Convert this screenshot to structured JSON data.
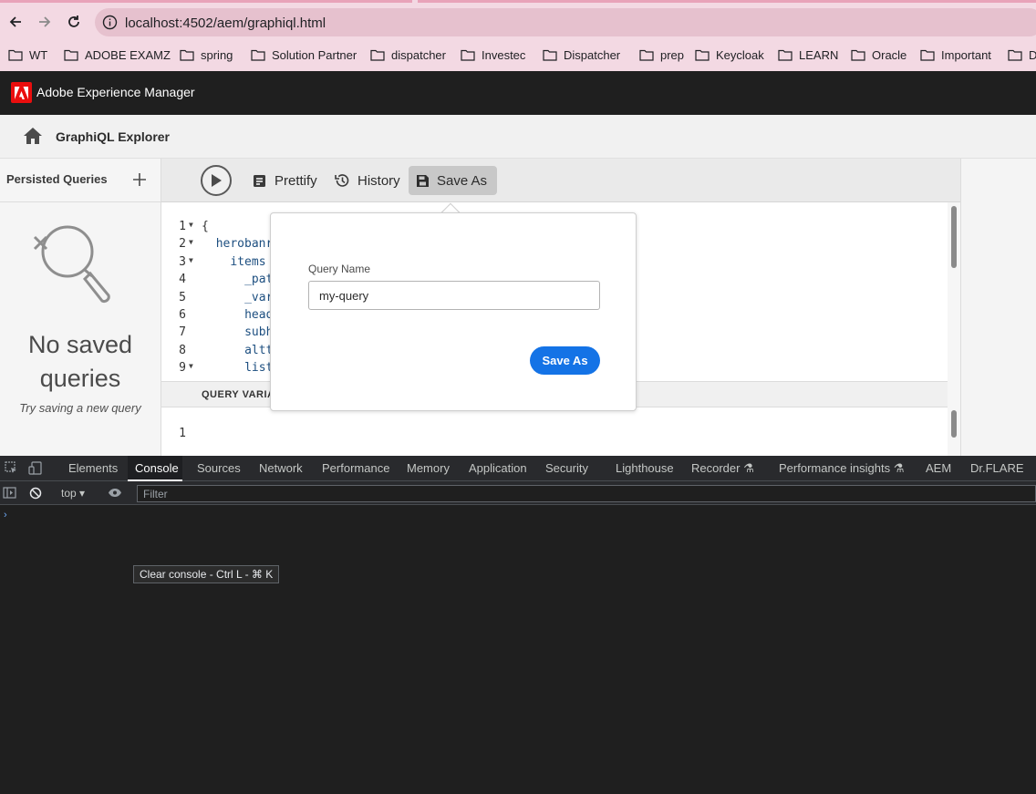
{
  "browser": {
    "url": "localhost:4502/aem/graphiql.html",
    "bookmarks": [
      "WT",
      "ADOBE EXAMZ",
      "spring",
      "Solution Partner",
      "dispatcher",
      "Investec",
      "Dispatcher",
      "prep",
      "Keycloak",
      "LEARN",
      "Oracle",
      "Important",
      "Di"
    ]
  },
  "aem": {
    "product_name": "Adobe Experience Manager",
    "page_title": "GraphiQL Explorer"
  },
  "persisted_queries": {
    "title": "Persisted Queries",
    "empty_title": "No saved queries",
    "empty_subtitle": "Try saving a new query"
  },
  "toolbar": {
    "prettify_label": "Prettify",
    "history_label": "History",
    "save_as_label": "Save As"
  },
  "editor": {
    "lines": [
      {
        "n": "1",
        "text": "{",
        "indent": 0,
        "fold": true
      },
      {
        "n": "2",
        "text": "herobanr",
        "indent": 1,
        "fold": true
      },
      {
        "n": "3",
        "text": "items",
        "indent": 2,
        "fold": true
      },
      {
        "n": "4",
        "text": "_pat",
        "indent": 3,
        "fold": false
      },
      {
        "n": "5",
        "text": "_var",
        "indent": 3,
        "fold": false
      },
      {
        "n": "6",
        "text": "head",
        "indent": 3,
        "fold": false
      },
      {
        "n": "7",
        "text": "subh",
        "indent": 3,
        "fold": false
      },
      {
        "n": "8",
        "text": "altt",
        "indent": 3,
        "fold": false
      },
      {
        "n": "9",
        "text": "list",
        "indent": 3,
        "fold": true
      }
    ],
    "variables_label": "QUERY VARIA",
    "variables_line": "1"
  },
  "save_popover": {
    "label": "Query Name",
    "value": "my-query",
    "button_label": "Save As"
  },
  "devtools": {
    "tabs": [
      "Elements",
      "Console",
      "Sources",
      "Network",
      "Performance",
      "Memory",
      "Application",
      "Security",
      "Lighthouse",
      "Recorder ⚗",
      "Performance insights ⚗",
      "AEM",
      "Dr.FLARE"
    ],
    "active_tab": "Console",
    "context": "top",
    "filter_placeholder": "Filter",
    "prompt": "›",
    "tooltip": "Clear console - Ctrl L - ⌘ K"
  }
}
